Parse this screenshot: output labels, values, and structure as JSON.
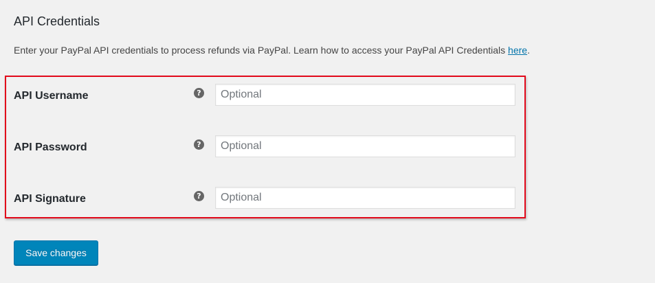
{
  "section": {
    "title": "API Credentials",
    "description": "Enter your PayPal API credentials to process refunds via PayPal. Learn how to access your PayPal API Credentials ",
    "link_text": "here",
    "description_end": "."
  },
  "fields": [
    {
      "label": "API Username",
      "placeholder": "Optional",
      "value": "",
      "help_icon": "help-icon"
    },
    {
      "label": "API Password",
      "placeholder": "Optional",
      "value": "",
      "help_icon": "help-icon"
    },
    {
      "label": "API Signature",
      "placeholder": "Optional",
      "value": "",
      "help_icon": "help-icon"
    }
  ],
  "buttons": {
    "save_label": "Save changes"
  },
  "colors": {
    "highlight_border": "#e2081a",
    "primary_button": "#0085ba",
    "link": "#0073aa"
  }
}
